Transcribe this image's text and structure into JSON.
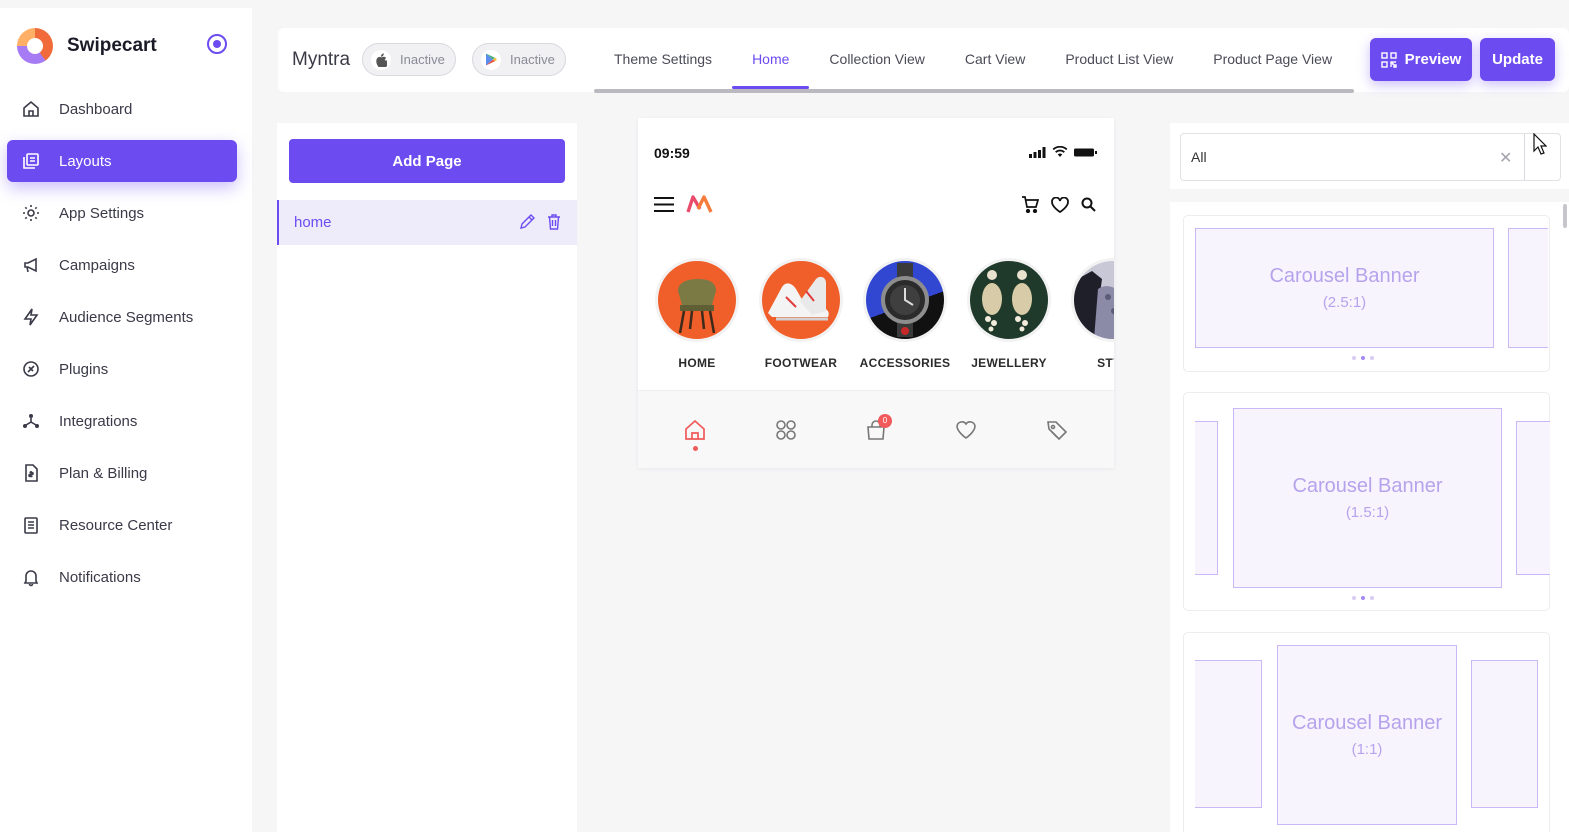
{
  "brand": {
    "name": "Swipecart"
  },
  "sidebar": {
    "items": [
      {
        "label": "Dashboard",
        "icon": "home-icon",
        "active": false
      },
      {
        "label": "Layouts",
        "icon": "layouts-icon",
        "active": true
      },
      {
        "label": "App Settings",
        "icon": "gear-icon",
        "active": false
      },
      {
        "label": "Campaigns",
        "icon": "megaphone-icon",
        "active": false
      },
      {
        "label": "Audience Segments",
        "icon": "bolt-icon",
        "active": false
      },
      {
        "label": "Plugins",
        "icon": "plugin-icon",
        "active": false
      },
      {
        "label": "Integrations",
        "icon": "integrations-icon",
        "active": false
      },
      {
        "label": "Plan & Billing",
        "icon": "billing-icon",
        "active": false
      },
      {
        "label": "Resource Center",
        "icon": "document-icon",
        "active": false
      },
      {
        "label": "Notifications",
        "icon": "bell-icon",
        "active": false
      }
    ]
  },
  "topbar": {
    "app_name": "Myntra",
    "ios_status": "Inactive",
    "android_status": "Inactive",
    "tabs": [
      "Theme Settings",
      "Home",
      "Collection View",
      "Cart View",
      "Product List View",
      "Product Page View"
    ],
    "active_tab": "Home",
    "preview_label": "Preview",
    "update_label": "Update"
  },
  "pages": {
    "add_label": "Add Page",
    "items": [
      {
        "name": "home"
      }
    ]
  },
  "phone": {
    "time": "09:59",
    "categories": [
      "HOME",
      "FOOTWEAR",
      "ACCESSORIES",
      "JEWELLERY",
      "STYL"
    ],
    "cart_badge": "0"
  },
  "widgets": {
    "filter_value": "All",
    "cards": [
      {
        "title": "Carousel Banner",
        "ratio": "(2.5:1)"
      },
      {
        "title": "Carousel Banner",
        "ratio": "(1.5:1)"
      },
      {
        "title": "Carousel Banner",
        "ratio": "(1:1)"
      }
    ]
  },
  "colors": {
    "accent": "#6c4bf0",
    "badge": "#f05a5a"
  }
}
